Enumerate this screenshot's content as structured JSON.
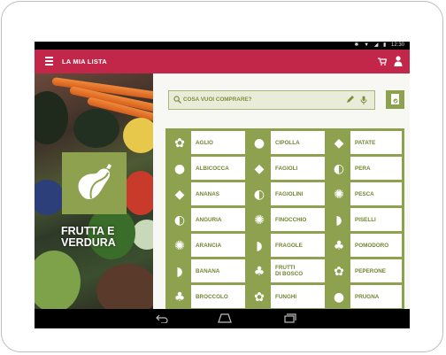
{
  "status": {
    "time": "12:30",
    "bluetooth": "bluetooth-icon",
    "wifi": "wifi-icon",
    "battery": "battery-icon"
  },
  "appbar": {
    "title": "LA MIA LISTA",
    "menu_icon": "menu-icon",
    "cart_icon": "cart-icon",
    "account_icon": "person-icon"
  },
  "search": {
    "placeholder": "COSA VUOI COMPRARE?",
    "edit_icon": "pencil-icon",
    "mic_icon": "mic-icon"
  },
  "category": {
    "label_line1": "FRUTTA E",
    "label_line2": "VERDURA",
    "icon": "eggplant-icon"
  },
  "list_button_icon": "shopping-list-icon",
  "items": [
    [
      "AGLIO",
      "CIPOLLA",
      "PATATE"
    ],
    [
      "ALBICOCCA",
      "FAGIOLI",
      "PERA"
    ],
    [
      "ANANAS",
      "FAGIOLINI",
      "PESCA"
    ],
    [
      "ANGURIA",
      "FINOCCHIO",
      "PISELLI"
    ],
    [
      "ARANCIA",
      "FRAGOLE",
      "POMODORO"
    ],
    [
      "BANANA",
      "FRUTTI\nDI BOSCO",
      "PEPERONE"
    ],
    [
      "BROCCOLO",
      "FUNGHI",
      "PRUGNA"
    ]
  ],
  "navbar": {
    "back_icon": "back-icon",
    "home_icon": "home-icon",
    "recents_icon": "recents-icon"
  },
  "colors": {
    "appbar": "#c2274a",
    "accent_green": "#8ea14f",
    "text_green": "#728531"
  }
}
